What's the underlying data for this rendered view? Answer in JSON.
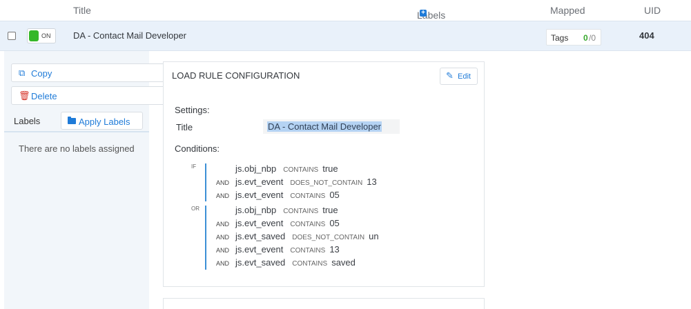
{
  "header": {
    "title": "Title",
    "labels": "Labels",
    "labels_plus_icon": "plus-square-icon",
    "mapped": "Mapped",
    "uid": "UID"
  },
  "row": {
    "toggle_label": "ON",
    "title": "DA - Contact Mail Developer",
    "tags_label": "Tags",
    "tags_count": "0",
    "tags_total": "/0",
    "uid": "404"
  },
  "sidebar": {
    "copy_label": "Copy",
    "delete_label": "Delete",
    "labels_label": "Labels",
    "apply_labels": "Apply Labels",
    "no_labels": "There are no labels assigned"
  },
  "panel": {
    "title": "LOAD RULE CONFIGURATION",
    "edit_label": "Edit",
    "settings_heading": "Settings:",
    "title_field_label": "Title",
    "title_field_value": "DA - Contact Mail Developer",
    "conditions_heading": "Conditions:",
    "groups": [
      {
        "label": "IF",
        "conditions": [
          {
            "conj": "",
            "var": "js.obj_nbp",
            "op": "CONTAINS",
            "val": "true"
          },
          {
            "conj": "AND",
            "var": "js.evt_event",
            "op": "DOES_NOT_CONTAIN",
            "val": "13"
          },
          {
            "conj": "AND",
            "var": "js.evt_event",
            "op": "CONTAINS",
            "val": "05"
          }
        ]
      },
      {
        "label": "OR",
        "conditions": [
          {
            "conj": "",
            "var": "js.obj_nbp",
            "op": "CONTAINS",
            "val": "true"
          },
          {
            "conj": "AND",
            "var": "js.evt_event",
            "op": "CONTAINS",
            "val": "05"
          },
          {
            "conj": "AND",
            "var": "js.evt_saved",
            "op": "DOES_NOT_CONTAIN",
            "val": "un"
          },
          {
            "conj": "AND",
            "var": "js.evt_event",
            "op": "CONTAINS",
            "val": "13"
          },
          {
            "conj": "AND",
            "var": "js.evt_saved",
            "op": "CONTAINS",
            "val": "saved"
          }
        ]
      }
    ]
  },
  "colors": {
    "accent": "#1f7bd8",
    "on_green": "#35b729",
    "row_bg": "#e9f1fa",
    "selection": "#b5d3f3"
  }
}
